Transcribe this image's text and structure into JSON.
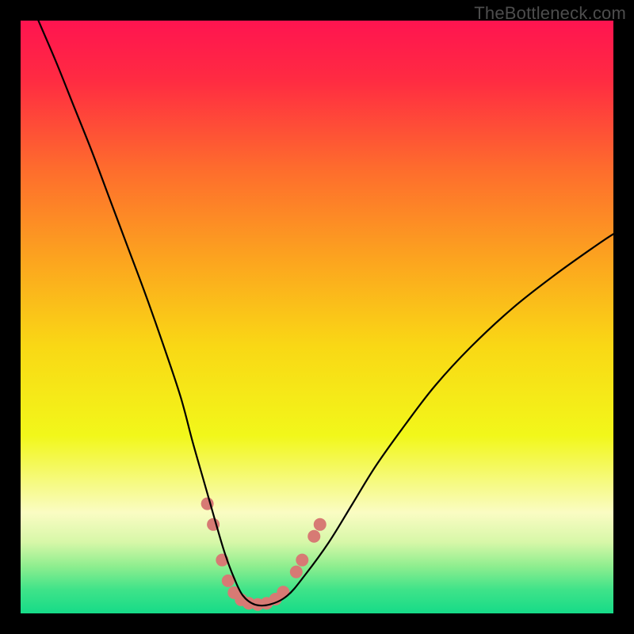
{
  "watermark": "TheBottleneck.com",
  "chart_data": {
    "type": "line",
    "title": "",
    "xlabel": "",
    "ylabel": "",
    "xlim": [
      0,
      100
    ],
    "ylim": [
      0,
      100
    ],
    "background_gradient": {
      "stops": [
        {
          "offset": 0.0,
          "color": "#ff1450"
        },
        {
          "offset": 0.1,
          "color": "#ff2b42"
        },
        {
          "offset": 0.25,
          "color": "#fe6c2d"
        },
        {
          "offset": 0.4,
          "color": "#fca31f"
        },
        {
          "offset": 0.55,
          "color": "#f9d815"
        },
        {
          "offset": 0.7,
          "color": "#f2f71a"
        },
        {
          "offset": 0.78,
          "color": "#f6fa82"
        },
        {
          "offset": 0.83,
          "color": "#fafcc3"
        },
        {
          "offset": 0.88,
          "color": "#d7f7a8"
        },
        {
          "offset": 0.92,
          "color": "#8fee8f"
        },
        {
          "offset": 0.96,
          "color": "#3fe389"
        },
        {
          "offset": 1.0,
          "color": "#16db88"
        }
      ]
    },
    "series": [
      {
        "name": "bottleneck-curve",
        "color": "#000000",
        "width": 2.2,
        "x": [
          3,
          6,
          9,
          12,
          15,
          18,
          21,
          24,
          27,
          29,
          31,
          33,
          34.5,
          36,
          37.5,
          39.5,
          42,
          45,
          48,
          52,
          56,
          60,
          65,
          70,
          76,
          83,
          90,
          97,
          100
        ],
        "y": [
          100,
          93,
          85.5,
          78,
          70,
          62,
          54,
          45.5,
          36.5,
          29,
          22,
          15,
          10,
          6,
          3,
          1.5,
          1.5,
          3,
          6.5,
          12,
          18.5,
          25,
          32,
          38.5,
          45,
          51.5,
          57,
          62,
          64
        ]
      }
    ],
    "markers": {
      "name": "highlight-band",
      "color": "#d77a74",
      "radius": 8,
      "points": [
        {
          "x": 31.5,
          "y": 18.5
        },
        {
          "x": 32.5,
          "y": 15.0
        },
        {
          "x": 34.0,
          "y": 9.0
        },
        {
          "x": 35.0,
          "y": 5.5
        },
        {
          "x": 36.0,
          "y": 3.5
        },
        {
          "x": 37.2,
          "y": 2.3
        },
        {
          "x": 38.5,
          "y": 1.7
        },
        {
          "x": 40.0,
          "y": 1.5
        },
        {
          "x": 41.5,
          "y": 1.7
        },
        {
          "x": 43.0,
          "y": 2.4
        },
        {
          "x": 44.3,
          "y": 3.6
        },
        {
          "x": 46.5,
          "y": 7.0
        },
        {
          "x": 47.5,
          "y": 9.0
        },
        {
          "x": 49.5,
          "y": 13.0
        },
        {
          "x": 50.5,
          "y": 15.0
        }
      ]
    }
  }
}
